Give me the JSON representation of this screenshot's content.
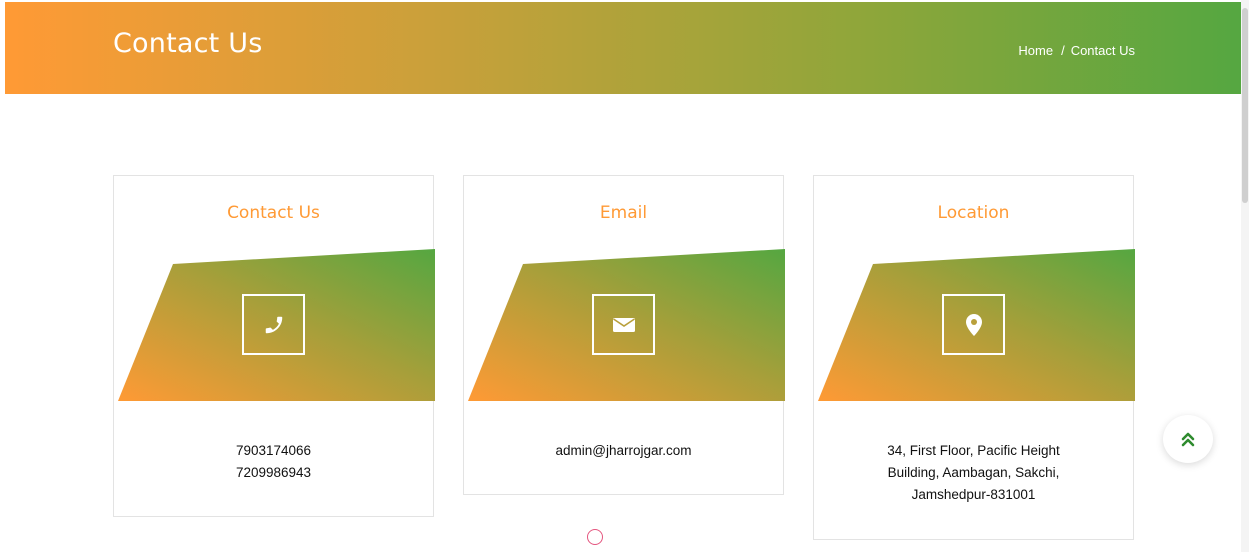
{
  "header": {
    "title": "Contact Us",
    "breadcrumb": {
      "home": "Home",
      "separator": "/",
      "current": "Contact Us"
    }
  },
  "cards": [
    {
      "title": "Contact Us",
      "icon": "phone-icon",
      "lines": [
        "7903174066",
        "7209986943"
      ]
    },
    {
      "title": "Email",
      "icon": "envelope-icon",
      "lines": [
        "admin@jharrojgar.com"
      ]
    },
    {
      "title": "Location",
      "icon": "map-marker-icon",
      "lines": [
        "34, First Floor, Pacific Height",
        "Building, Aambagan, Sakchi,",
        "Jamshedpur-831001"
      ]
    }
  ],
  "scroll_top": {
    "icon": "double-chevron-up-icon"
  },
  "colors": {
    "orange": "#ff9a35",
    "green": "#55a741",
    "accent_pink": "#e4567f"
  }
}
